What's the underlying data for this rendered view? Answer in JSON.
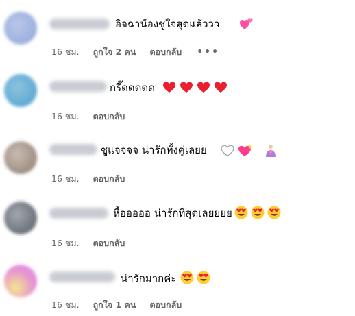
{
  "comments": [
    {
      "text": "อิจฉาน้องชูใจสุดแล้ววว",
      "time": "16 ชม.",
      "likes": "ถูกใจ 2 คน",
      "reply": "ตอบกลับ",
      "more": "•••",
      "emojis": [
        "two-hearts-icon"
      ],
      "avatar_colors": [
        "#8fa6d8",
        "#b9c6ea"
      ]
    },
    {
      "text": "กรี๊ดดดดด",
      "time": "16 ชม.",
      "reply": "ตอบกลับ",
      "emojis": [
        "red-heart-icon",
        "red-heart-icon",
        "red-heart-icon",
        "red-heart-icon"
      ],
      "avatar_colors": [
        "#4da0cf",
        "#8dc2de"
      ]
    },
    {
      "text": "ชูแจจจจ น่ารักทั้งคู่เลยย",
      "time": "16 ชม.",
      "reply": "ตอบกลับ",
      "emojis": [
        "white-heart-icon",
        "sparkling-heart-icon",
        "person-heart-hands-icon"
      ],
      "avatar_colors": [
        "#8c7a6f",
        "#c9bcb2"
      ]
    },
    {
      "text": "หื้อออออ น่ารักที่สุดเลยยยย",
      "time": "16 ชม.",
      "reply": "ตอบกลับ",
      "emojis": [
        "heart-eyes-face-icon",
        "heart-eyes-face-icon",
        "heart-eyes-face-icon"
      ],
      "avatar_colors": [
        "#555a63",
        "#a3a7ae"
      ]
    },
    {
      "text": "น่ารักมากค่ะ",
      "time": "16 ชม.",
      "likes": "ถูกใจ 1 คน",
      "reply": "ตอบกลับ",
      "emojis": [
        "heart-eyes-face-icon",
        "heart-eyes-face-icon"
      ],
      "avatar_colors": [
        "#e58ed6",
        "#f5e68c"
      ]
    }
  ]
}
